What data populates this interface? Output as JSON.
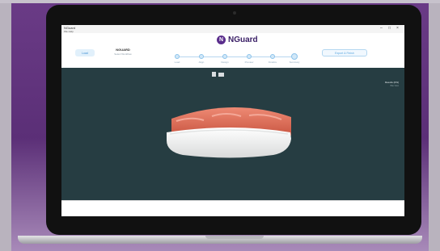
{
  "window": {
    "title": "NGuard",
    "menu": "File  Help"
  },
  "app": {
    "logo_mark": "N",
    "logo_text": "NGuard"
  },
  "header": {
    "left_button": "Load",
    "center_title": "NGUARD",
    "center_subtitle": "Select Workflow",
    "right_button": "Export & Finish"
  },
  "steps": [
    "Load",
    "Align",
    "Design",
    "Preview",
    "Finalize",
    "Summary"
  ],
  "viewport": {
    "side_title": "Results (0%)",
    "side_sub": "Bite View"
  },
  "colors": {
    "accent": "#5a2d8c",
    "viewport_bg": "#263d42",
    "gum": "#e0674f",
    "guard": "#f4f4f4"
  }
}
